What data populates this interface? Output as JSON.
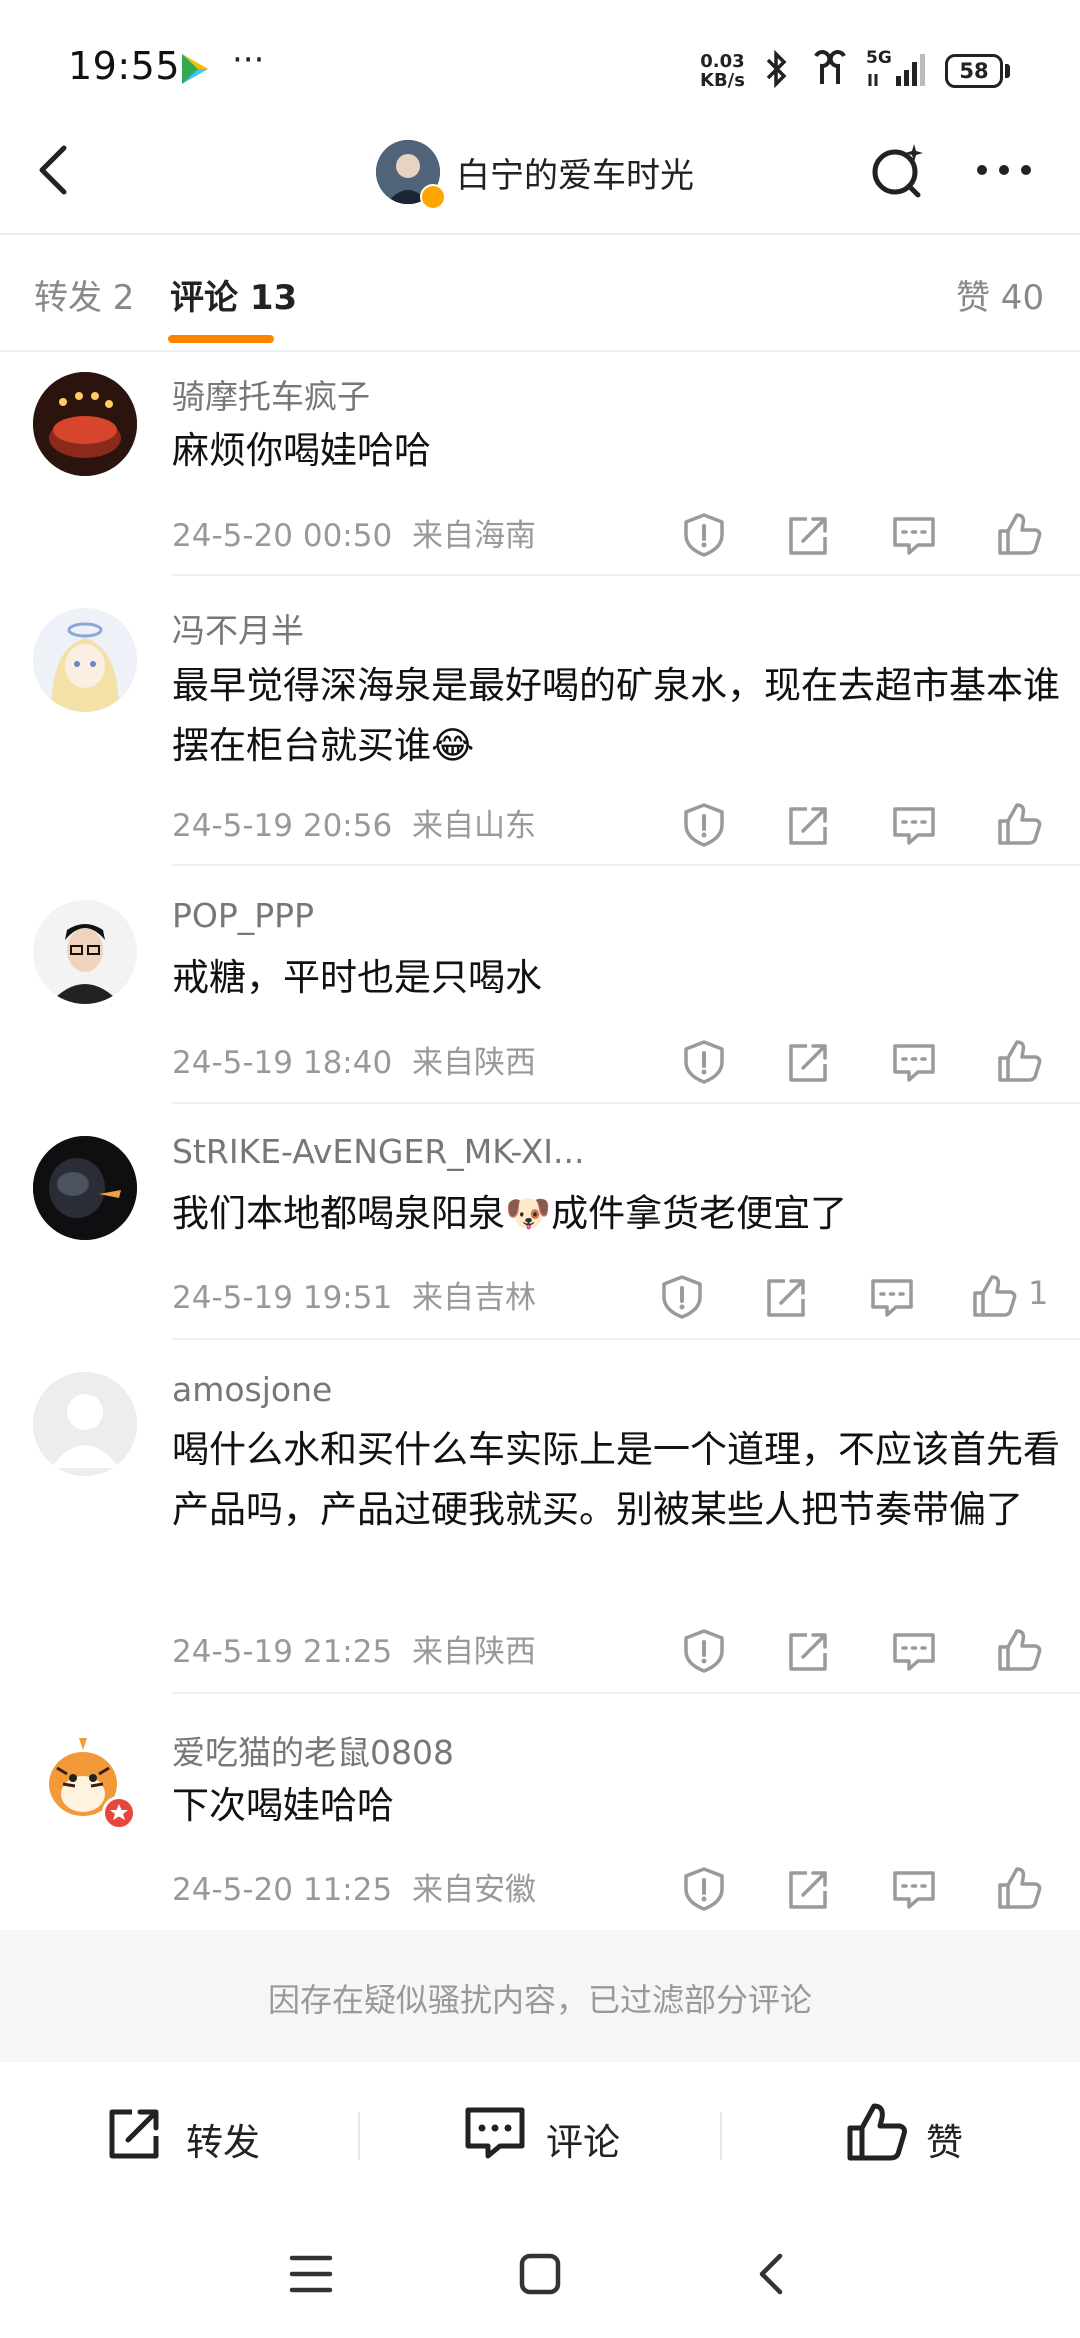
{
  "status_bar": {
    "time": "19:55",
    "more": "···",
    "net_speed_value": "0.03",
    "net_speed_unit": "KB/s",
    "signal": "5G",
    "battery": "58",
    "icons": [
      "bluetooth-icon",
      "earbuds-icon",
      "signal-icon",
      "battery-icon"
    ]
  },
  "header": {
    "title": "白宁的爱车时光",
    "icons": [
      "back-icon",
      "search-icon",
      "more-icon"
    ]
  },
  "tabs": {
    "repost": "转发 2",
    "comments": "评论 13",
    "likes": "赞 40",
    "active": "comments",
    "accent_color": "#ff8200"
  },
  "comments": [
    {
      "name": "骑摩托车疯子",
      "text": "麻烦你喝娃哈哈",
      "date": "24-5-20 00:50",
      "location": "来自海南",
      "likes": ""
    },
    {
      "name": "冯不月半",
      "text": "最早觉得深海泉是最好喝的矿泉水，现在去超市基本谁摆在柜台就买谁😂",
      "date": "24-5-19 20:56",
      "location": "来自山东",
      "likes": ""
    },
    {
      "name": "POP_PPP",
      "text": "戒糖，平时也是只喝水",
      "date": "24-5-19 18:40",
      "location": "来自陕西",
      "likes": ""
    },
    {
      "name": "StRIKE-AvENGER_MK-XI...",
      "text": "我们本地都喝泉阳泉🐶成件拿货老便宜了",
      "date": "24-5-19 19:51",
      "location": "来自吉林",
      "likes": "1"
    },
    {
      "name": "amosjone",
      "text": "喝什么水和买什么车实际上是一个道理，不应该首先看产品吗，产品过硬我就买。别被某些人把节奏带偏了",
      "date": "24-5-19 21:25",
      "location": "来自陕西",
      "likes": ""
    },
    {
      "name": "爱吃猫的老鼠0808",
      "text": "下次喝娃哈哈",
      "date": "24-5-20 11:25",
      "location": "来自安徽",
      "likes": ""
    }
  ],
  "filter_note": "因存在疑似骚扰内容，已过滤部分评论",
  "toolbar": {
    "repost": "转发",
    "comment": "评论",
    "like": "赞"
  },
  "navbar": {
    "icons": [
      "menu-icon",
      "home-icon",
      "back-nav-icon"
    ]
  }
}
